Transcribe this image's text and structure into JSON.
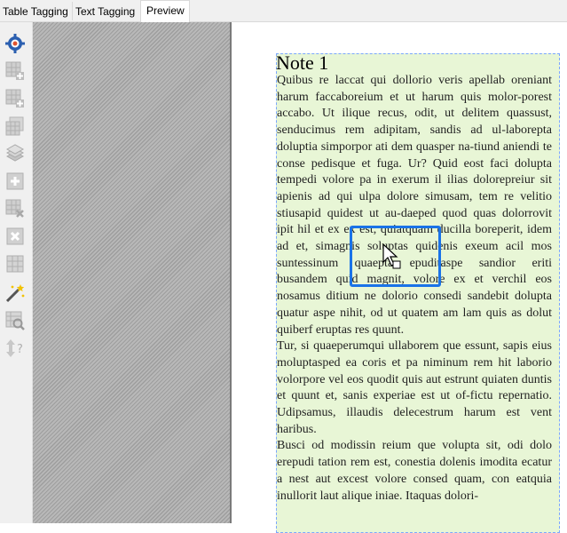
{
  "tabs": [
    {
      "label": "Table Tagging"
    },
    {
      "label": "Text Tagging"
    },
    {
      "label": "Preview"
    }
  ],
  "toolbar": {
    "icons": [
      "settings-icon",
      "table-add-icon",
      "table-add-column-icon",
      "table-copy-icon",
      "table-stack-icon",
      "table-plus-icon",
      "table-delete-icon",
      "cell-delete-icon",
      "grid-icon",
      "magic-wand-icon",
      "table-search-icon",
      "row-order-icon"
    ]
  },
  "note": {
    "title": "Note 1",
    "paragraphs": [
      "Quibus re laccat qui dollorio veris apellab oreniant harum faccaboreium et ut harum quis molor-porest accabo. Ut ilique recus, odit, ut delitem quassust, senducimus rem adipitam, sandis ad ul-laborepta doluptia simporpor ati dem quasper na-tiund aniendi te conse pedisque et fuga. Ur? Quid eost faci dolupta tempedi volore pa in exerum il ilias dolorepreiur sit apienis ad qui ulpa dolore simusam, tem re velitio stiusapid quidest ut au-daeped quod quas dolorrovit ipit hil et ex ex est, quiatquam ducilla boreperit, idem ad et, simagnis soluptas quidenis exeum acil mos suntessinum quaepta epuditaspe sandior eriti busandem quid magnit, volore ex et verchil eos nosamus ditium ne dolorio consedi sandebit dolupta quatur aspe nihit, od ut quatem am lam quis as dolut quiberf eruptas res quunt.",
      "Tur, si quaeperumqui ullaborem que essunt, sapis eius moluptasped ea coris et pa niminum rem hit laborio volorpore vel eos quodit quis aut estrunt quiaten duntis et quunt et, sanis experiae est ut of-fictu repernatio. Udipsamus, illaudis delecestrum harum est vent haribus.",
      "Busci od modissin reium que volupta sit, odi dolo erepudi tation rem est, conestia dolenis imodita ecatur a nest aut excest volore consed quam, con eatquia inullorit laut alique iniae. Itaquas dolori-"
    ]
  },
  "colors": {
    "note_fill": "#e8f6d6",
    "note_border": "#7aa6ff",
    "selection": "#1a73e8"
  }
}
